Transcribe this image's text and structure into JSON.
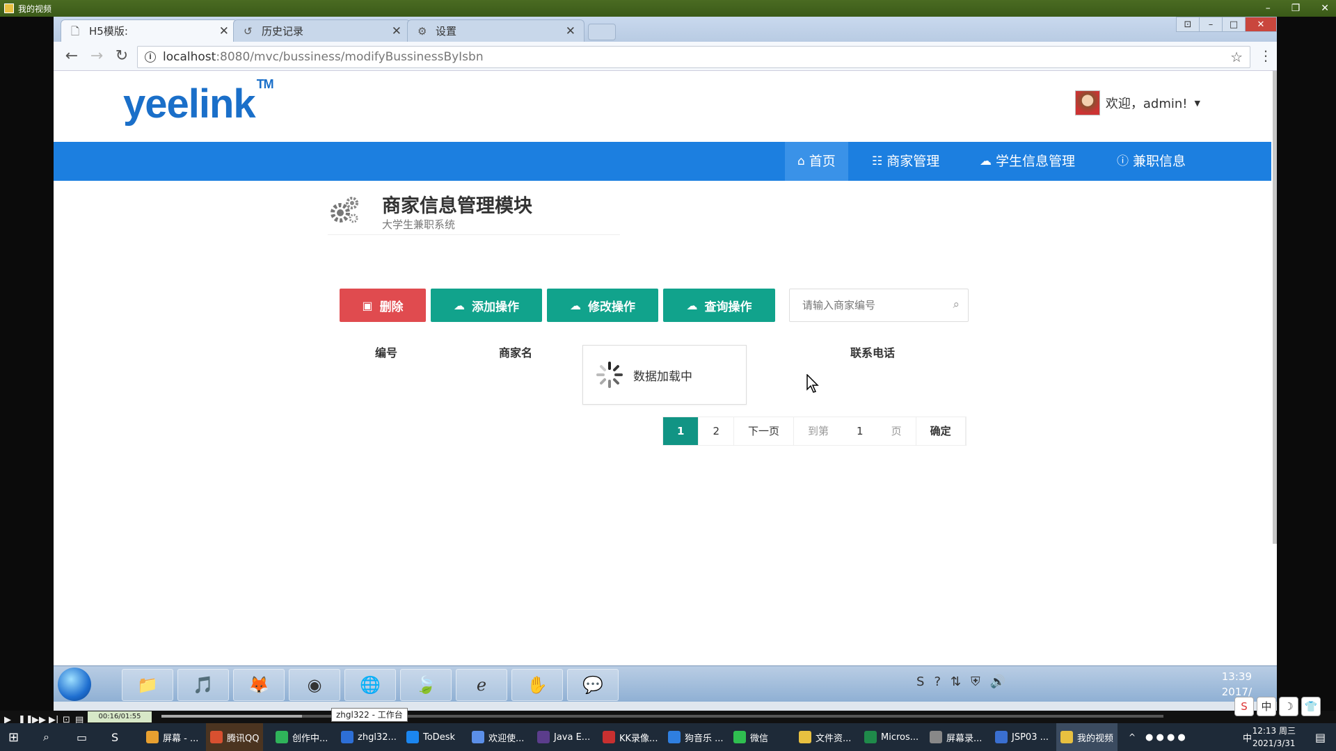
{
  "player": {
    "title": "我的视频",
    "time": "00:16/01:55",
    "tooltip": "zhgl322 - 工作台"
  },
  "browser": {
    "tabs": [
      {
        "label": "H5模版:",
        "icon": "document-icon",
        "active": true
      },
      {
        "label": "历史记录",
        "icon": "history-icon",
        "active": false
      },
      {
        "label": "设置",
        "icon": "gear-icon",
        "active": false
      }
    ],
    "url_host": "localhost",
    "url_rest": ":8080/mvc/bussiness/modifyBussinessByIsbn"
  },
  "site": {
    "logo": "yeelink",
    "logo_tm": "TM",
    "welcome": "欢迎，admin!",
    "nav": [
      {
        "label": "首页",
        "icon": "home-icon",
        "active": true
      },
      {
        "label": "商家管理",
        "icon": "sitemap-icon",
        "active": false
      },
      {
        "label": "学生信息管理",
        "icon": "cloud-icon",
        "active": false
      },
      {
        "label": "兼职信息",
        "icon": "info-icon",
        "active": false
      }
    ]
  },
  "module": {
    "title": "商家信息管理模块",
    "subtitle": "大学生兼职系统"
  },
  "actions": {
    "delete": "删除",
    "add": "添加操作",
    "edit": "修改操作",
    "query": "查询操作",
    "search_placeholder": "请输入商家编号"
  },
  "table": {
    "headers": [
      "编号",
      "商家名",
      "联系电话"
    ],
    "loading": "数据加载中"
  },
  "pager": {
    "pages": [
      "1",
      "2"
    ],
    "current": "1",
    "next": "下一页",
    "goto_prefix": "到第",
    "goto_value": "1",
    "goto_suffix": "页",
    "confirm": "确定"
  },
  "inner_taskbar": {
    "time": "13:39",
    "date": "2017/"
  },
  "taskbar": {
    "items": [
      {
        "label": "屏幕 - ...",
        "color": "#e8a030"
      },
      {
        "label": "腾讯QQ",
        "color": "#d85030"
      },
      {
        "label": "创作中...",
        "color": "#2fb35a"
      },
      {
        "label": "zhgl32...",
        "color": "#2d6fd6"
      },
      {
        "label": "ToDesk",
        "color": "#1b86f0"
      },
      {
        "label": "欢迎使...",
        "color": "#5b8fe8"
      },
      {
        "label": "Java E...",
        "color": "#5b3d8c"
      },
      {
        "label": "KK录像...",
        "color": "#c83030"
      },
      {
        "label": "狗音乐 ...",
        "color": "#2f7fe0"
      },
      {
        "label": "微信",
        "color": "#2fbf50"
      },
      {
        "label": "文件资...",
        "color": "#e8c040"
      },
      {
        "label": "Micros...",
        "color": "#1f8a4a"
      },
      {
        "label": "屏幕录...",
        "color": "#888888"
      },
      {
        "label": "JSP03 ...",
        "color": "#3a6fd0"
      },
      {
        "label": "我的视频",
        "color": "#e8c040"
      }
    ],
    "time": "12:13 周三",
    "date": "2021/3/31"
  }
}
